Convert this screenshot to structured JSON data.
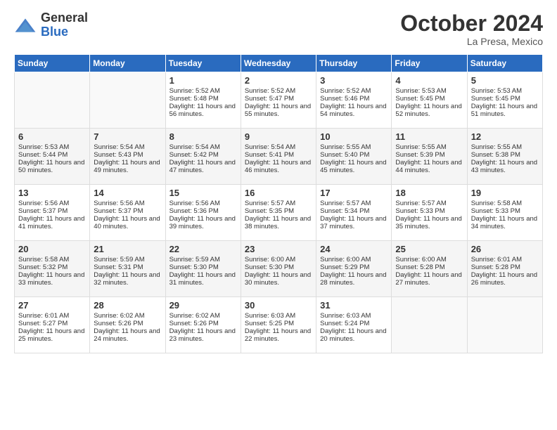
{
  "header": {
    "logo_general": "General",
    "logo_blue": "Blue",
    "month": "October 2024",
    "location": "La Presa, Mexico"
  },
  "days_of_week": [
    "Sunday",
    "Monday",
    "Tuesday",
    "Wednesday",
    "Thursday",
    "Friday",
    "Saturday"
  ],
  "weeks": [
    [
      {
        "day": "",
        "info": ""
      },
      {
        "day": "",
        "info": ""
      },
      {
        "day": "1",
        "sunrise": "Sunrise: 5:52 AM",
        "sunset": "Sunset: 5:48 PM",
        "daylight": "Daylight: 11 hours and 56 minutes."
      },
      {
        "day": "2",
        "sunrise": "Sunrise: 5:52 AM",
        "sunset": "Sunset: 5:47 PM",
        "daylight": "Daylight: 11 hours and 55 minutes."
      },
      {
        "day": "3",
        "sunrise": "Sunrise: 5:52 AM",
        "sunset": "Sunset: 5:46 PM",
        "daylight": "Daylight: 11 hours and 54 minutes."
      },
      {
        "day": "4",
        "sunrise": "Sunrise: 5:53 AM",
        "sunset": "Sunset: 5:45 PM",
        "daylight": "Daylight: 11 hours and 52 minutes."
      },
      {
        "day": "5",
        "sunrise": "Sunrise: 5:53 AM",
        "sunset": "Sunset: 5:45 PM",
        "daylight": "Daylight: 11 hours and 51 minutes."
      }
    ],
    [
      {
        "day": "6",
        "sunrise": "Sunrise: 5:53 AM",
        "sunset": "Sunset: 5:44 PM",
        "daylight": "Daylight: 11 hours and 50 minutes."
      },
      {
        "day": "7",
        "sunrise": "Sunrise: 5:54 AM",
        "sunset": "Sunset: 5:43 PM",
        "daylight": "Daylight: 11 hours and 49 minutes."
      },
      {
        "day": "8",
        "sunrise": "Sunrise: 5:54 AM",
        "sunset": "Sunset: 5:42 PM",
        "daylight": "Daylight: 11 hours and 47 minutes."
      },
      {
        "day": "9",
        "sunrise": "Sunrise: 5:54 AM",
        "sunset": "Sunset: 5:41 PM",
        "daylight": "Daylight: 11 hours and 46 minutes."
      },
      {
        "day": "10",
        "sunrise": "Sunrise: 5:55 AM",
        "sunset": "Sunset: 5:40 PM",
        "daylight": "Daylight: 11 hours and 45 minutes."
      },
      {
        "day": "11",
        "sunrise": "Sunrise: 5:55 AM",
        "sunset": "Sunset: 5:39 PM",
        "daylight": "Daylight: 11 hours and 44 minutes."
      },
      {
        "day": "12",
        "sunrise": "Sunrise: 5:55 AM",
        "sunset": "Sunset: 5:38 PM",
        "daylight": "Daylight: 11 hours and 43 minutes."
      }
    ],
    [
      {
        "day": "13",
        "sunrise": "Sunrise: 5:56 AM",
        "sunset": "Sunset: 5:37 PM",
        "daylight": "Daylight: 11 hours and 41 minutes."
      },
      {
        "day": "14",
        "sunrise": "Sunrise: 5:56 AM",
        "sunset": "Sunset: 5:37 PM",
        "daylight": "Daylight: 11 hours and 40 minutes."
      },
      {
        "day": "15",
        "sunrise": "Sunrise: 5:56 AM",
        "sunset": "Sunset: 5:36 PM",
        "daylight": "Daylight: 11 hours and 39 minutes."
      },
      {
        "day": "16",
        "sunrise": "Sunrise: 5:57 AM",
        "sunset": "Sunset: 5:35 PM",
        "daylight": "Daylight: 11 hours and 38 minutes."
      },
      {
        "day": "17",
        "sunrise": "Sunrise: 5:57 AM",
        "sunset": "Sunset: 5:34 PM",
        "daylight": "Daylight: 11 hours and 37 minutes."
      },
      {
        "day": "18",
        "sunrise": "Sunrise: 5:57 AM",
        "sunset": "Sunset: 5:33 PM",
        "daylight": "Daylight: 11 hours and 35 minutes."
      },
      {
        "day": "19",
        "sunrise": "Sunrise: 5:58 AM",
        "sunset": "Sunset: 5:33 PM",
        "daylight": "Daylight: 11 hours and 34 minutes."
      }
    ],
    [
      {
        "day": "20",
        "sunrise": "Sunrise: 5:58 AM",
        "sunset": "Sunset: 5:32 PM",
        "daylight": "Daylight: 11 hours and 33 minutes."
      },
      {
        "day": "21",
        "sunrise": "Sunrise: 5:59 AM",
        "sunset": "Sunset: 5:31 PM",
        "daylight": "Daylight: 11 hours and 32 minutes."
      },
      {
        "day": "22",
        "sunrise": "Sunrise: 5:59 AM",
        "sunset": "Sunset: 5:30 PM",
        "daylight": "Daylight: 11 hours and 31 minutes."
      },
      {
        "day": "23",
        "sunrise": "Sunrise: 6:00 AM",
        "sunset": "Sunset: 5:30 PM",
        "daylight": "Daylight: 11 hours and 30 minutes."
      },
      {
        "day": "24",
        "sunrise": "Sunrise: 6:00 AM",
        "sunset": "Sunset: 5:29 PM",
        "daylight": "Daylight: 11 hours and 28 minutes."
      },
      {
        "day": "25",
        "sunrise": "Sunrise: 6:00 AM",
        "sunset": "Sunset: 5:28 PM",
        "daylight": "Daylight: 11 hours and 27 minutes."
      },
      {
        "day": "26",
        "sunrise": "Sunrise: 6:01 AM",
        "sunset": "Sunset: 5:28 PM",
        "daylight": "Daylight: 11 hours and 26 minutes."
      }
    ],
    [
      {
        "day": "27",
        "sunrise": "Sunrise: 6:01 AM",
        "sunset": "Sunset: 5:27 PM",
        "daylight": "Daylight: 11 hours and 25 minutes."
      },
      {
        "day": "28",
        "sunrise": "Sunrise: 6:02 AM",
        "sunset": "Sunset: 5:26 PM",
        "daylight": "Daylight: 11 hours and 24 minutes."
      },
      {
        "day": "29",
        "sunrise": "Sunrise: 6:02 AM",
        "sunset": "Sunset: 5:26 PM",
        "daylight": "Daylight: 11 hours and 23 minutes."
      },
      {
        "day": "30",
        "sunrise": "Sunrise: 6:03 AM",
        "sunset": "Sunset: 5:25 PM",
        "daylight": "Daylight: 11 hours and 22 minutes."
      },
      {
        "day": "31",
        "sunrise": "Sunrise: 6:03 AM",
        "sunset": "Sunset: 5:24 PM",
        "daylight": "Daylight: 11 hours and 20 minutes."
      },
      {
        "day": "",
        "info": ""
      },
      {
        "day": "",
        "info": ""
      }
    ]
  ]
}
